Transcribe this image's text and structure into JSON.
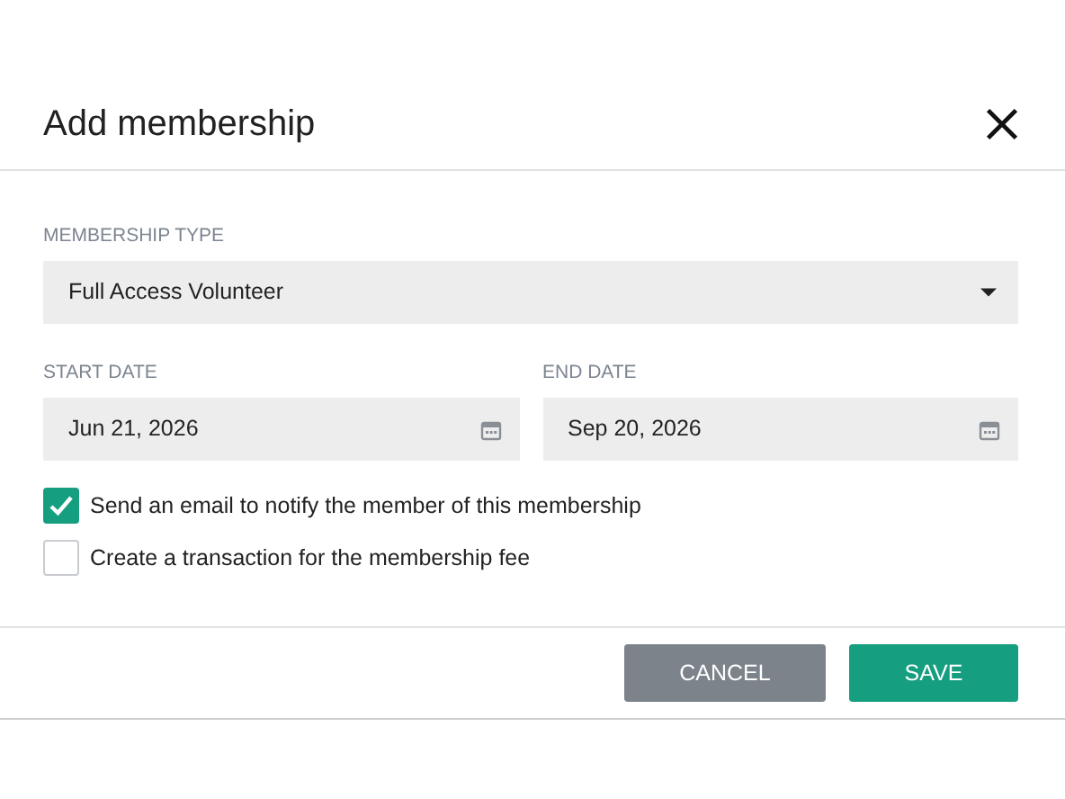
{
  "dialog": {
    "title": "Add membership"
  },
  "membership_type": {
    "label": "MEMBERSHIP TYPE",
    "value": "Full Access Volunteer"
  },
  "dates": [
    {
      "label": "START DATE",
      "value": "Jun 21, 2026"
    },
    {
      "label": "END DATE",
      "value": "Sep 20, 2026"
    }
  ],
  "options": [
    {
      "label": "Send an email to notify the member of this membership",
      "checked": true
    },
    {
      "label": "Create a transaction for the membership fee",
      "checked": false
    }
  ],
  "buttons": [
    {
      "label": "CANCEL",
      "kind": "secondary"
    },
    {
      "label": "SAVE",
      "kind": "primary"
    }
  ]
}
